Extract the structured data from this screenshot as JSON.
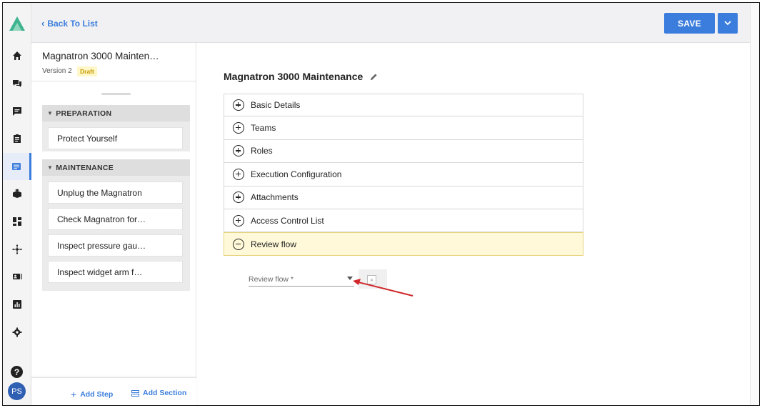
{
  "topbar": {
    "back_label": "Back To List",
    "save_label": "SAVE"
  },
  "sidebar": {
    "title": "Magnatron 3000 Mainten…",
    "version": "Version 2",
    "badge": "Draft",
    "sections": [
      {
        "label": "PREPARATION",
        "steps": [
          "Protect Yourself"
        ]
      },
      {
        "label": "MAINTENANCE",
        "steps": [
          "Unplug the Magnatron",
          "Check Magnatron for…",
          "Inspect pressure gau…",
          "Inspect widget arm f…"
        ]
      }
    ],
    "add_step_label": "Add Step",
    "add_section_label": "Add Section"
  },
  "rail": {
    "items": [
      "home-icon",
      "chat-icon",
      "message-icon",
      "clipboard-icon",
      "procedures-icon",
      "learn-icon",
      "dashboard-icon",
      "network-icon",
      "contacts-icon",
      "reports-icon",
      "settings-icon"
    ],
    "help_label": "?",
    "avatar_initials": "PS"
  },
  "main": {
    "title": "Magnatron 3000 Maintenance",
    "accordion": [
      {
        "label": "Basic Details",
        "open": false
      },
      {
        "label": "Teams",
        "open": false
      },
      {
        "label": "Roles",
        "open": false
      },
      {
        "label": "Execution Configuration",
        "open": false
      },
      {
        "label": "Attachments",
        "open": false
      },
      {
        "label": "Access Control List",
        "open": false
      },
      {
        "label": "Review flow",
        "open": true
      }
    ],
    "review_flow_field": {
      "label": "Review flow *"
    },
    "clear_glyph": "×"
  },
  "colors": {
    "accent": "#3b7ddd",
    "draft_badge_bg": "#fff7c8",
    "open_row_bg": "#fff9d9",
    "annotation_arrow": "#d0282a"
  }
}
